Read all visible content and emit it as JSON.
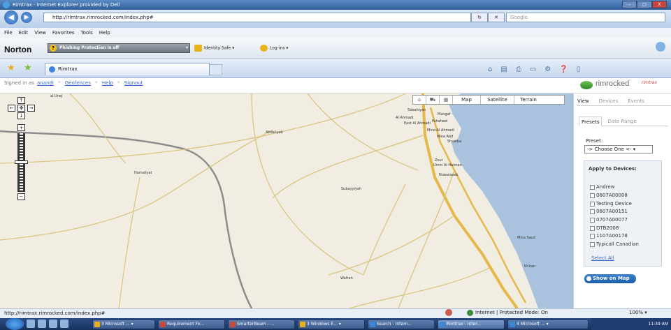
{
  "window": {
    "title": "Rimtrax - Internet Explorer provided by Dell",
    "min": "–",
    "max": "□",
    "close": "X"
  },
  "address": {
    "url": "http://rimtrax.rimrocked.com/index.php#",
    "search_placeholder": "Google",
    "back": "◀",
    "forward": "▶",
    "refresh": "↻",
    "stop": "✕"
  },
  "menu": [
    "File",
    "Edit",
    "View",
    "Favorites",
    "Tools",
    "Help"
  ],
  "norton": {
    "logo": "Norton",
    "phishing": "Phishing Protection is off",
    "idsafe": "Identity Safe ▾",
    "logins": "Log-ins ▾",
    "help": "?",
    "dropdown": "▾"
  },
  "tab": {
    "title": "Rimtrax"
  },
  "cmdbar": [
    "⌂",
    "▤",
    "⎙",
    "▭",
    "⚙",
    "❓",
    "▯"
  ],
  "favorites": {
    "star1": "★",
    "star2": "★"
  },
  "signed": {
    "prefix": "Signed in as",
    "user": "anandi",
    "geofences": "Geofences",
    "help": "Help",
    "signout": "Signout",
    "sep": "*"
  },
  "brand": {
    "name": "rimrocked",
    "sub": "rimtrax"
  },
  "map": {
    "types": [
      "Map",
      "Satellite",
      "Terrain"
    ],
    "type_icons": [
      "⌂",
      "⛟",
      "▦"
    ],
    "zoom": {
      "up": "↑",
      "left": "←",
      "center": "✥",
      "right": "→",
      "down": "↓",
      "plus": "+",
      "minus": "−"
    },
    "labels": {
      "top": "al Unej",
      "abdaliyah": "Abdaliyah",
      "hamaliyat": "Hamaliyat",
      "subayyiyah": "Subayyiyah",
      "wafrah": "Wafrah",
      "sabahiyah": "Sabahiyah",
      "mangaf": "Mangaf",
      "ahmadi": "Al Ahmadi",
      "fahaheel": "Fahaheel",
      "eastahmadi": "East Al Ahmadi",
      "mina_ahmadi": "Mina Al Ahmadi",
      "mina_abd": "Mina Abd",
      "shuaiba": "Shuaiba",
      "zour": "Zour",
      "khiran": "Khiran",
      "mina_saud": "Mina Saud",
      "nuwaiseeb": "Nuwaiseeb",
      "umm_al_haiman": "Umm Al Haiman"
    }
  },
  "panel": {
    "tabs": [
      "View",
      "Devices",
      "Events"
    ],
    "subtabs": [
      "Presets",
      "Date Range"
    ],
    "preset_label": "Preset:",
    "preset_value": "-> Choose One <-  ▾",
    "apply_title": "Apply to Devices:",
    "devices": [
      "Andrew",
      "0607A00008",
      "Testing Device",
      "0607A00151",
      "0707A00077",
      "DTB2008",
      "1107A00178",
      "Typicall Canadian"
    ],
    "select_all": "Select All",
    "show_on_map": "Show on Map"
  },
  "status": {
    "url": "http://rimtrax.rimrocked.com/index.php#",
    "zone": "Internet | Protected Mode: On",
    "zoom": "100%  ▾"
  },
  "taskbar": {
    "items": [
      "3 Microsoft ... ▾",
      "Requirement Fo...",
      "SmarterBeam - ...",
      "3 Windows E... ▾",
      "Search - Intern...",
      "Rimtrax - Inter...",
      "4 Microsoft ... ▾"
    ],
    "time": "11:39 AM"
  },
  "colors": {
    "road_major": "#e6b84a",
    "road_minor": "#d9c27a",
    "border": "#8c8c8c",
    "water": "#a9c3df",
    "land": "#f1ede2",
    "accent": "#2d65b0"
  }
}
